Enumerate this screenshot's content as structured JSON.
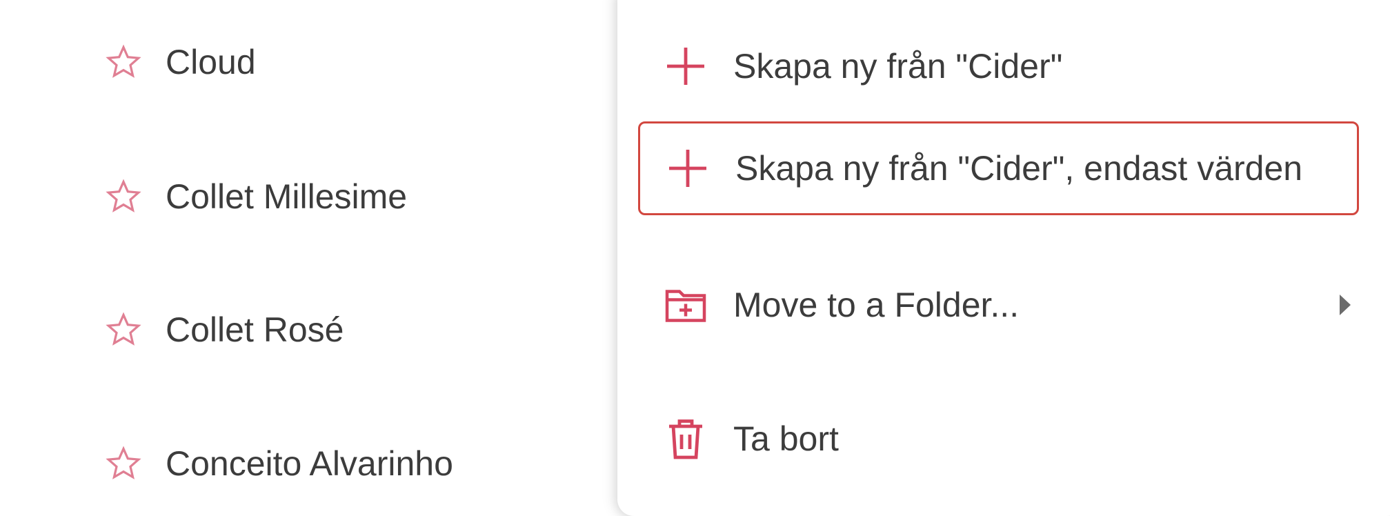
{
  "favorites": {
    "items": [
      {
        "label": "Cloud",
        "icon": "star-outline-icon"
      },
      {
        "label": "Collet Millesime",
        "icon": "star-outline-icon"
      },
      {
        "label": "Collet Rosé",
        "icon": "star-outline-icon"
      },
      {
        "label": "Conceito Alvarinho",
        "icon": "star-outline-icon"
      }
    ]
  },
  "context_menu": {
    "items": [
      {
        "label": "Skapa ny från \"Cider\"",
        "icon": "plus-icon",
        "highlighted": false,
        "has_submenu": false
      },
      {
        "label": "Skapa ny från \"Cider\", endast värden",
        "icon": "plus-icon",
        "highlighted": true,
        "has_submenu": false
      },
      {
        "label": "Move to a Folder...",
        "icon": "folder-add-icon",
        "highlighted": false,
        "has_submenu": true
      },
      {
        "label": "Ta bort",
        "icon": "trash-icon",
        "highlighted": false,
        "has_submenu": false
      }
    ]
  },
  "colors": {
    "accent": "#d5445f",
    "highlight_border": "#d2473f",
    "text": "#3c3c3c"
  }
}
